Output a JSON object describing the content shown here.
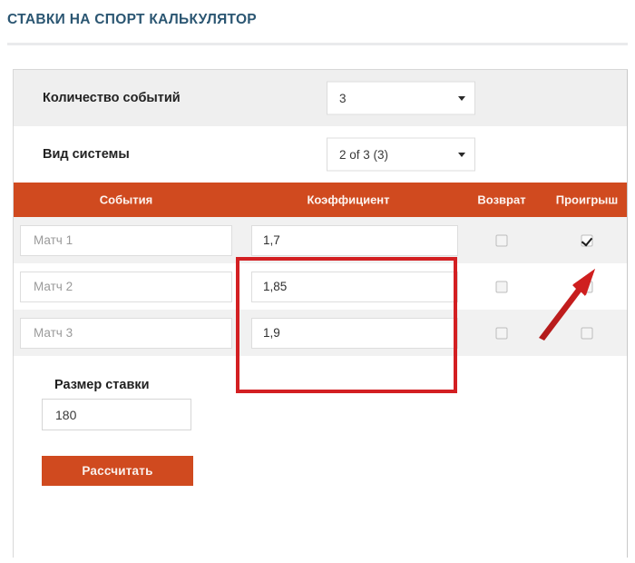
{
  "header": {
    "title": "СТАВКИ НА СПОРТ КАЛЬКУЛЯТОР",
    "title_color": "#2b5672"
  },
  "theme": {
    "accent_orange": "#d04a1f",
    "annotation_red": "#d31f22",
    "row_shade": "#f1f1f1"
  },
  "settings": [
    {
      "label": "Количество событий",
      "select_value": "3",
      "arrow_icon": "chevron-down-icon"
    },
    {
      "label": "Вид системы",
      "select_value": "2 of 3 (3)",
      "arrow_icon": "chevron-down-icon"
    }
  ],
  "table": {
    "columns": [
      "События",
      "Коэффициент",
      "Возврат",
      "Проигрыш"
    ],
    "rows": [
      {
        "event_placeholder": "Матч 1",
        "coefficient": "1,7",
        "return_checked": false,
        "loss_checked": true
      },
      {
        "event_placeholder": "Матч 2",
        "coefficient": "1,85",
        "return_checked": false,
        "loss_checked": false
      },
      {
        "event_placeholder": "Матч 3",
        "coefficient": "1,9",
        "return_checked": false,
        "loss_checked": false
      }
    ]
  },
  "stake": {
    "label": "Размер ставки",
    "value": "180",
    "button_label": "Рассчитать"
  },
  "annotations": {
    "coefficient_highlight": "red-rectangle-around-coefficient-column",
    "loss_checkbox_pointer": "red-arrow-icon"
  }
}
